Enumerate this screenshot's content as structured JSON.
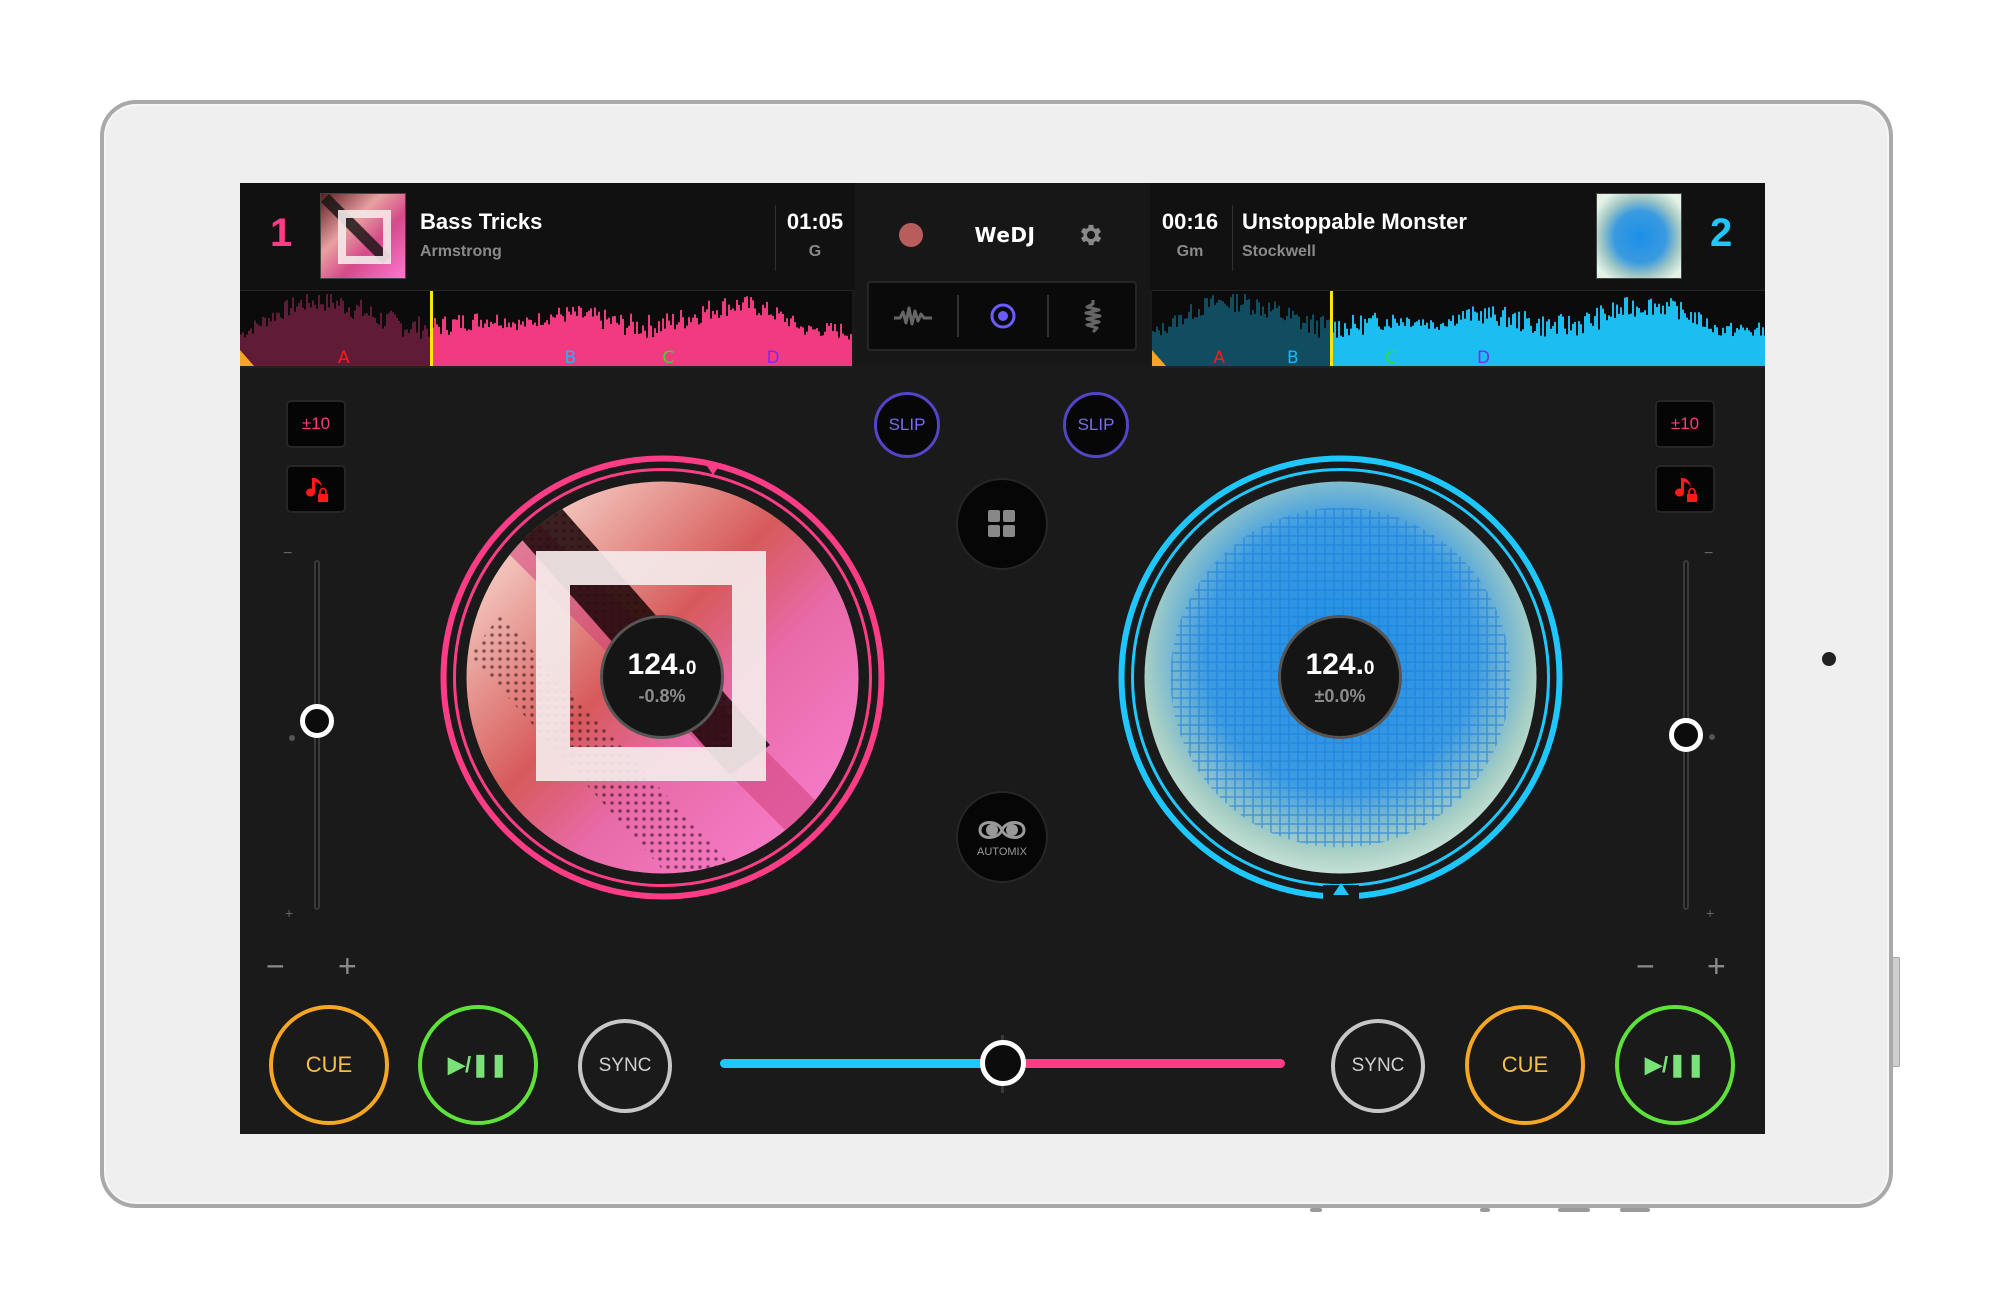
{
  "app": {
    "name": "WeDJ",
    "record_icon": "record-icon",
    "settings_icon": "gear-icon",
    "view_modes": [
      {
        "name": "waveform-view",
        "icon": "waveform-icon",
        "active": false
      },
      {
        "name": "jog-view",
        "icon": "target-icon",
        "active": true
      },
      {
        "name": "vertical-waveform-view",
        "icon": "vertical-waveform-icon",
        "active": false
      }
    ]
  },
  "colors": {
    "deck1_accent": "#ff3d87",
    "deck2_accent": "#1ec8ff",
    "cue_button": "#f5a623",
    "play_button": "#5ee23a",
    "slip": "#5344c8",
    "playhead": "#ffe600",
    "record_dot": "#b85c5c"
  },
  "deck1": {
    "number": "1",
    "title": "Bass Tricks",
    "artist": "Armstrong",
    "time": "01:05",
    "key": "G",
    "bpm_int": "124.",
    "bpm_dec": "0",
    "pitch_percent": "-0.8%",
    "pitch_range_label": "±10",
    "key_lock_icon": "music-note-lock-icon",
    "slip_label": "SLIP",
    "tempo_slider_value": 0.46,
    "playhead_position": 0.31,
    "hot_cues": [
      {
        "label": "A",
        "color": "#ff1a1a",
        "position": 0.17
      },
      {
        "label": "B",
        "color": "#19b7ff",
        "position": 0.54
      },
      {
        "label": "C",
        "color": "#33dd33",
        "position": 0.7
      },
      {
        "label": "D",
        "color": "#7b2bf0",
        "position": 0.87
      }
    ],
    "slider_minus": "−",
    "slider_plus": "+",
    "nudge_minus": "−",
    "nudge_plus": "+",
    "cue_label": "CUE",
    "play_label": "▶/❚❚",
    "sync_label": "SYNC"
  },
  "deck2": {
    "number": "2",
    "title": "Unstoppable Monster",
    "artist": "Stockwell",
    "time": "00:16",
    "key": "Gm",
    "bpm_int": "124.",
    "bpm_dec": "0",
    "pitch_percent": "±0.0%",
    "pitch_range_label": "±10",
    "key_lock_icon": "music-note-lock-icon",
    "slip_label": "SLIP",
    "tempo_slider_value": 0.5,
    "playhead_position": 0.29,
    "hot_cues": [
      {
        "label": "A",
        "color": "#ff1a1a",
        "position": 0.11
      },
      {
        "label": "B",
        "color": "#19b7ff",
        "position": 0.23
      },
      {
        "label": "C",
        "color": "#33dd33",
        "position": 0.39
      },
      {
        "label": "D",
        "color": "#7b2bf0",
        "position": 0.54
      }
    ],
    "slider_minus": "−",
    "slider_plus": "+",
    "nudge_minus": "−",
    "nudge_plus": "+",
    "cue_label": "CUE",
    "play_label": "▶/❚❚",
    "sync_label": "SYNC"
  },
  "center": {
    "grid_icon": "grid-icon",
    "automix_label": "AUTOMIX"
  },
  "crossfader": {
    "value": 0.5
  }
}
